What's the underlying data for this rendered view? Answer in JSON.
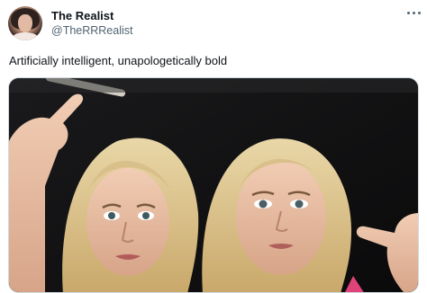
{
  "author": {
    "display_name": "The Realist",
    "handle": "@TheRRRealist",
    "avatar_icon": "profile-avatar"
  },
  "post": {
    "text": "Artificially intelligent, unapologetically bold",
    "more_icon": "more-horizontal-icon"
  },
  "colors": {
    "text_primary": "#0f1419",
    "text_secondary": "#536471",
    "media_border": "#cfd9de"
  }
}
